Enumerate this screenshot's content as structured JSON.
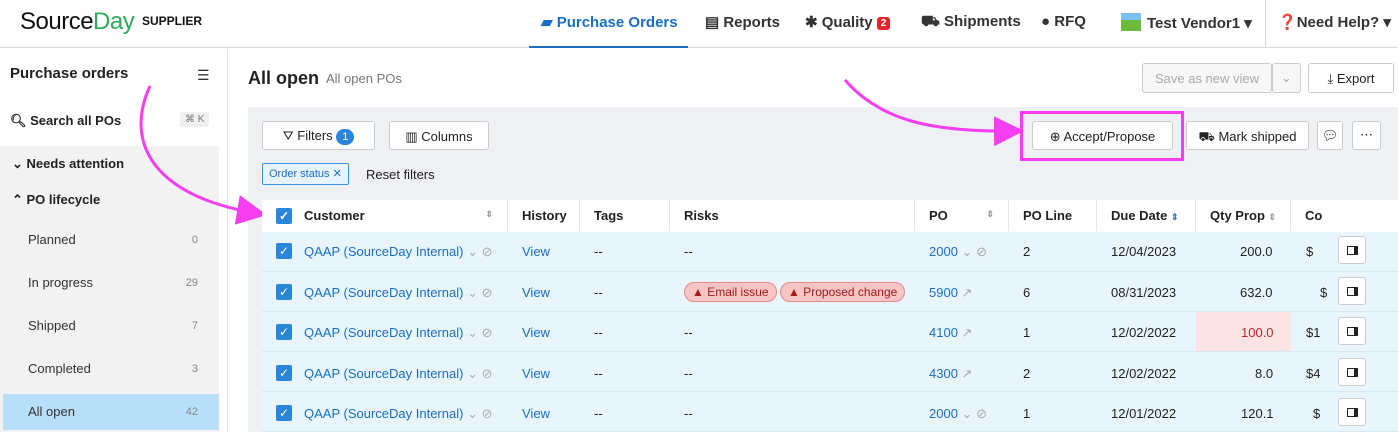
{
  "brand": {
    "part1": "Source",
    "part2": "Day",
    "sub": "SUPPLIER"
  },
  "nav": {
    "purchase_orders": "Purchase Orders",
    "reports": "Reports",
    "quality": "Quality",
    "quality_badge": "2",
    "shipments": "Shipments",
    "rfq": "RFQ",
    "vendor": "Test Vendor1",
    "help": "Need Help?"
  },
  "sidebar": {
    "title": "Purchase orders",
    "search": "Search all POs",
    "shortcut": "⌘ K",
    "needs_attention": "Needs attention",
    "lifecycle": "PO lifecycle",
    "items": [
      {
        "label": "Planned",
        "count": "0"
      },
      {
        "label": "In progress",
        "count": "29"
      },
      {
        "label": "Shipped",
        "count": "7"
      },
      {
        "label": "Completed",
        "count": "3"
      },
      {
        "label": "All open",
        "count": "42"
      }
    ]
  },
  "main": {
    "title": "All open",
    "subtitle": "All open POs"
  },
  "toolbar": {
    "save_view": "Save as new view",
    "export": "Export",
    "filters": "Filters",
    "filters_count": "1",
    "columns": "Columns",
    "accept": "Accept/Propose",
    "mark_shipped": "Mark shipped",
    "chip": "Order status",
    "reset": "Reset filters"
  },
  "table": {
    "headers": {
      "customer": "Customer",
      "history": "History",
      "tags": "Tags",
      "risks": "Risks",
      "po": "PO",
      "po_line": "PO Line",
      "due": "Due Date",
      "qty": "Qty Prop",
      "cost": "Co"
    },
    "rows": [
      {
        "customer": "QAAP (SourceDay Internal)",
        "history": "View",
        "tags": "--",
        "risks": "--",
        "po": "2000",
        "line": "2",
        "due": "12/04/2023",
        "qty": "200.0",
        "cost": "$"
      },
      {
        "customer": "QAAP (SourceDay Internal)",
        "history": "View",
        "tags": "--",
        "risk1": "Email issue",
        "risk2": "Proposed change",
        "po": "5900",
        "line": "6",
        "due": "08/31/2023",
        "qty": "632.0",
        "cost": "$"
      },
      {
        "customer": "QAAP (SourceDay Internal)",
        "history": "View",
        "tags": "--",
        "risks": "--",
        "po": "4100",
        "line": "1",
        "due": "12/02/2022",
        "qty": "100.0",
        "cost": "$1"
      },
      {
        "customer": "QAAP (SourceDay Internal)",
        "history": "View",
        "tags": "--",
        "risks": "--",
        "po": "4300",
        "line": "2",
        "due": "12/02/2022",
        "qty": "8.0",
        "cost": "$4"
      },
      {
        "customer": "QAAP (SourceDay Internal)",
        "history": "View",
        "tags": "--",
        "risks": "--",
        "po": "2000",
        "line": "1",
        "due": "12/01/2022",
        "qty": "120.1",
        "cost": "$"
      }
    ]
  },
  "colors": {
    "accent": "#1a6fc4",
    "highlight": "#f43ef0",
    "brand_green": "#2eaa5c"
  }
}
